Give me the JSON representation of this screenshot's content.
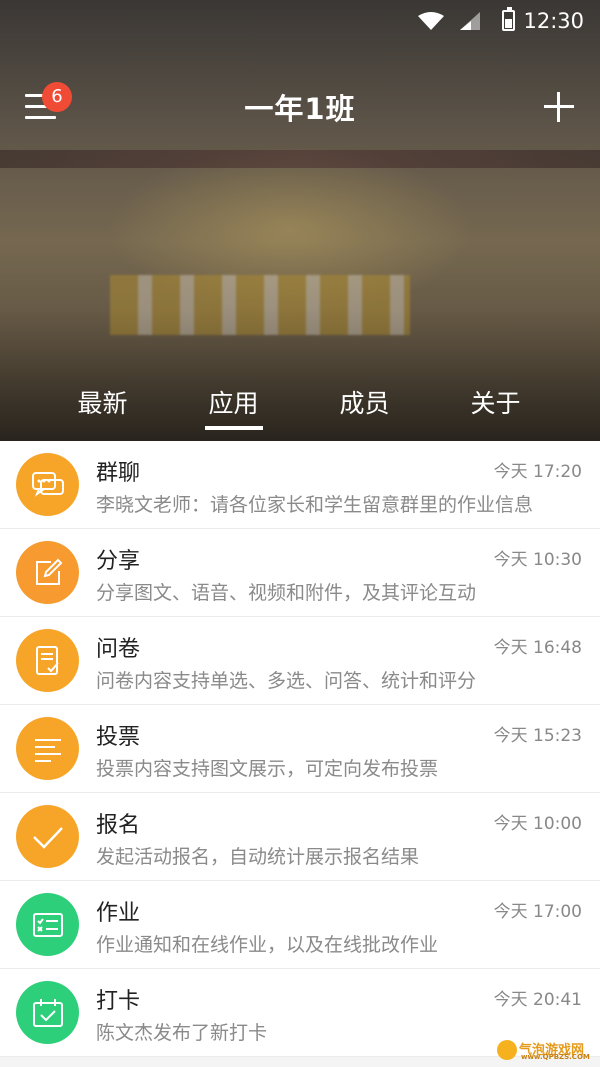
{
  "status_bar": {
    "time": "12:30"
  },
  "header": {
    "title": "一年1班",
    "menu_badge": "6"
  },
  "tabs": [
    {
      "label": "最新",
      "active": false
    },
    {
      "label": "应用",
      "active": true
    },
    {
      "label": "成员",
      "active": false
    },
    {
      "label": "关于",
      "active": false
    }
  ],
  "apps": [
    {
      "name": "群聊",
      "time": "今天 17:20",
      "desc": "李晓文老师：请各位家长和学生留意群里的作业信息",
      "icon": "chat-icon",
      "color": "#f7a529"
    },
    {
      "name": "分享",
      "time": "今天 10:30",
      "desc": "分享图文、语音、视频和附件，及其评论互动",
      "icon": "edit-icon",
      "color": "#f79b30"
    },
    {
      "name": "问卷",
      "time": "今天 16:48",
      "desc": "问卷内容支持单选、多选、问答、统计和评分",
      "icon": "survey-icon",
      "color": "#f7a529"
    },
    {
      "name": "投票",
      "time": "今天 15:23",
      "desc": "投票内容支持图文展示，可定向发布投票",
      "icon": "vote-icon",
      "color": "#f7a529"
    },
    {
      "name": "报名",
      "time": "今天 10:00",
      "desc": "发起活动报名，自动统计展示报名结果",
      "icon": "check-icon",
      "color": "#f7a529"
    },
    {
      "name": "作业",
      "time": "今天 17:00",
      "desc": "作业通知和在线作业，以及在线批改作业",
      "icon": "homework-icon",
      "color": "#2ecf7a"
    },
    {
      "name": "打卡",
      "time": "今天 20:41",
      "desc": "陈文杰发布了新打卡",
      "icon": "calendar-check-icon",
      "color": "#2ecf7a"
    }
  ],
  "watermark": {
    "text": "气泡游戏网",
    "sub": "www.QPBZS.COM"
  }
}
